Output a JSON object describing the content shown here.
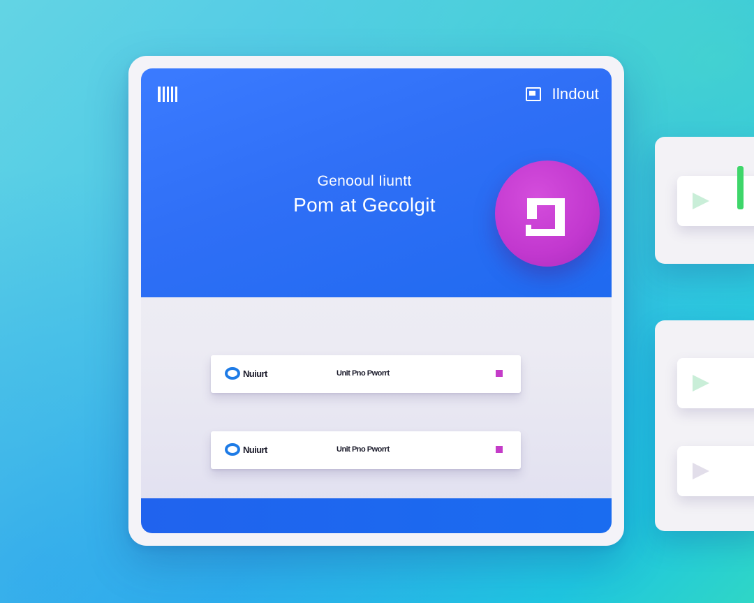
{
  "header": {
    "menu_icon": "menu-bars-icon",
    "account_icon": "window-icon",
    "account_label": "Ilndout"
  },
  "hero": {
    "line1": "Genooul Iiuntt",
    "line2": "Pom at Gecolgit",
    "fab_icon": "square-frame-icon"
  },
  "list": {
    "rows": [
      {
        "name": "Nuiurt",
        "meta": "Unit Pno Pworrt"
      },
      {
        "name": "Nuiurt",
        "meta": "Unit Pno Pworrt"
      }
    ]
  },
  "side": {
    "tile_icon": "play-icon"
  },
  "colors": {
    "hero_blue": "#2f6ff6",
    "fab_magenta": "#c238cf",
    "accent_green": "#3ed66a",
    "radio_blue": "#1e7be6",
    "dot_magenta": "#c43cc8"
  }
}
